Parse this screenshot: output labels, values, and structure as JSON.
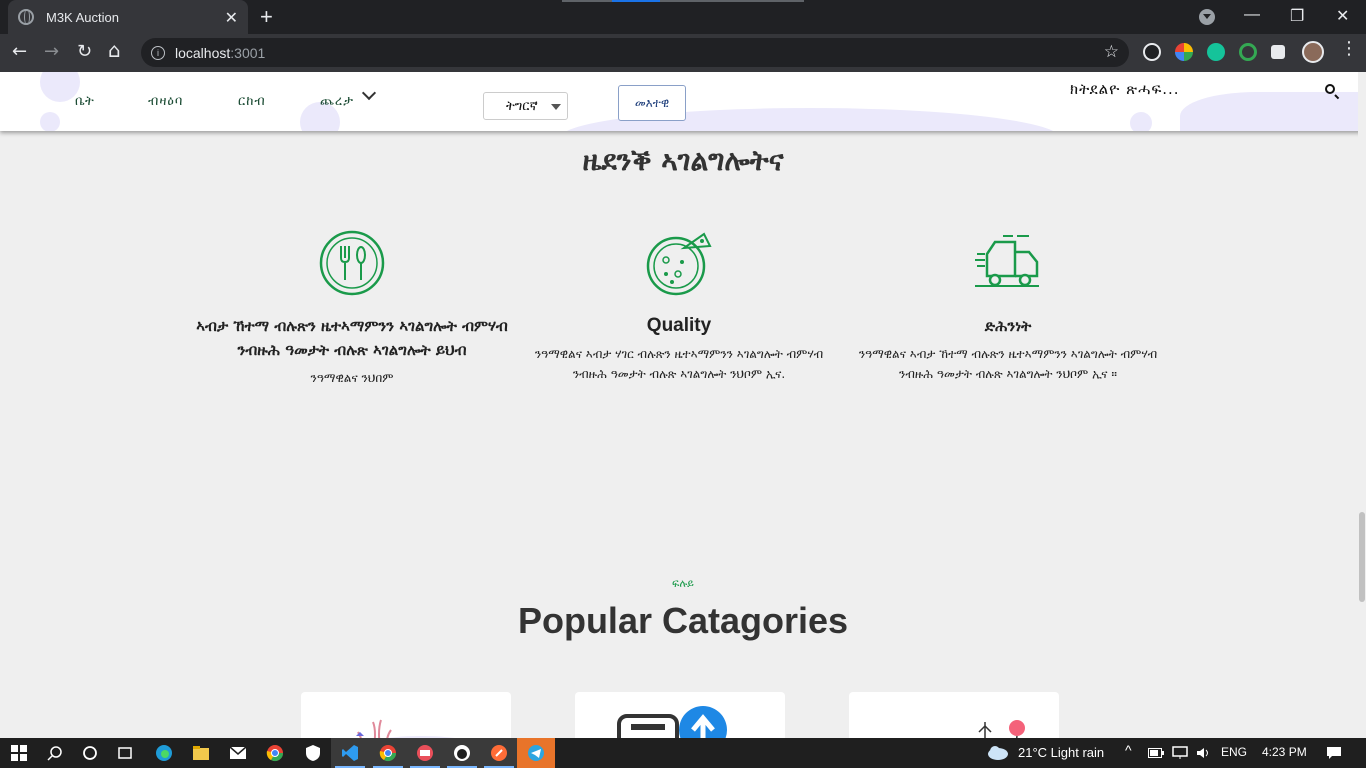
{
  "browser": {
    "tab_title": "M3K Auction",
    "tab_close": "✕",
    "new_tab": "+",
    "url_host": "localhost",
    "url_port": ":3001",
    "info_glyph": "i",
    "star_glyph": "☆",
    "back_glyph": "←",
    "forward_glyph": "→",
    "reload_glyph": "↻",
    "home_glyph": "⌂",
    "minimize_glyph": "—",
    "restore_glyph": "❐",
    "close_glyph": "✕"
  },
  "navbar": {
    "links": [
      "ቤት",
      "ብዛዕባ",
      "ርከብ",
      "ጨረታ"
    ],
    "language": "ትግርኛ",
    "login_button": "መእተዊ",
    "search_label": "ክትደልዮ ጽሓፍ..."
  },
  "services": {
    "heading": "ዜደንቕ ኣገልግሎትና",
    "cards": [
      {
        "icon": "restaurant-icon",
        "title": "ኣብታ ኸተማ ብሉጽን ዜተኣማምንን ኣገልግሎት ብምሃብ ንብዙሕ ዓመታት ብሉጽ ኣገልግሎት ይህብ",
        "desc": "ንዓማዊልና ንህበም"
      },
      {
        "icon": "pizza-icon",
        "title": "Quality",
        "desc": "ንዓማዊልና ኣብታ ሃገር ብሉጽን ዜተኣማምንን ኣገልግሎት ብምሃብ ንብዙሕ ዓመታት ብሉጽ ኣገልግሎት ንህቦም ኢና."
      },
      {
        "icon": "delivery-truck-icon",
        "title": "ድሕንነት",
        "desc": "ንዓማዊልና ኣብታ ኸተማ ብሉጽን ዜተኣማምንን ኣገልግሎት ብምሃብ ንብዙሕ ዓመታት ብሉጽ ኣገልግሎት ንህቦም ኢና ።"
      }
    ]
  },
  "categories": {
    "kicker": "ፍሉይ",
    "title": "Popular Catagories"
  },
  "taskbar": {
    "weather": "21°C  Light rain",
    "language": "ENG",
    "time": "4:23 PM"
  },
  "colors": {
    "accent_green": "#1a9a4a",
    "browser_dark": "#202124"
  }
}
